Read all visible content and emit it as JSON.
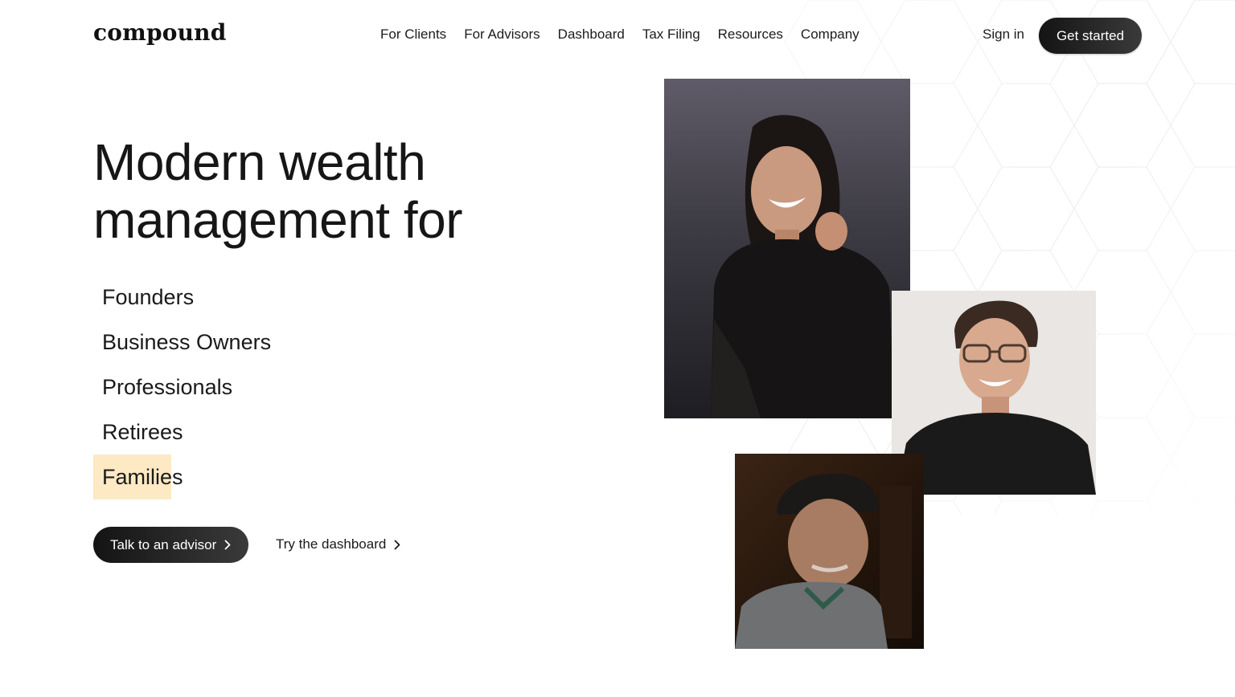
{
  "header": {
    "logo": "compound",
    "nav": [
      "For Clients",
      "For Advisors",
      "Dashboard",
      "Tax Filing",
      "Resources",
      "Company"
    ],
    "sign_in": "Sign in",
    "get_started": "Get started"
  },
  "hero": {
    "headline_line1": "Modern wealth",
    "headline_line2": "management for",
    "audiences": [
      "Founders",
      "Business Owners",
      "Professionals",
      "Retirees",
      "Families"
    ],
    "highlighted_audience": "Families",
    "primary_cta": "Talk to an advisor",
    "secondary_cta": "Try the dashboard"
  },
  "photos": [
    {
      "subject": "smiling woman in black sweater",
      "icon": "portrait-photo"
    },
    {
      "subject": "smiling man with glasses",
      "icon": "portrait-photo"
    },
    {
      "subject": "older man in flat cap",
      "icon": "portrait-photo"
    }
  ],
  "colors": {
    "button_dark": "#141414",
    "highlight": "#fde9c4",
    "text": "#1a1a1a"
  }
}
